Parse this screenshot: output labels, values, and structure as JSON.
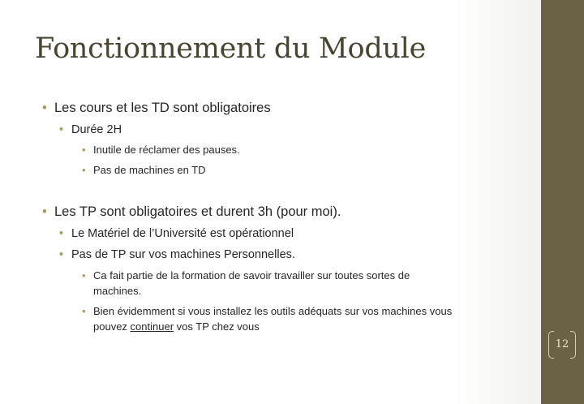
{
  "slide": {
    "title": "Fonctionnement du Module",
    "bullets": {
      "b1": "Les cours et les TD sont obligatoires",
      "b1_1": "Durée 2H",
      "b1_1_1": "Inutile de réclamer des pauses.",
      "b1_1_2": "Pas de machines en TD",
      "b2": "Les TP sont obligatoires et durent 3h (pour moi).",
      "b2_1": "Le Matériel de l’Université est opérationnel",
      "b2_2": "Pas de TP sur vos machines Personnelles.",
      "b2_2_1_line1": "Ca fait partie de la formation de savoir travailler sur toutes sortes de",
      "b2_2_1_line2": "machines.",
      "b2_2_2_line1": "Bien évidemment si vous installez les outils adéquats sur vos machines vous",
      "b2_2_2_pre": "pouvez ",
      "b2_2_2_link": "continuer",
      "b2_2_2_post": " vos TP chez vous"
    },
    "bullet_glyph": "•",
    "page_number": "12"
  },
  "colors": {
    "title": "#4a4330",
    "bullet": "#a49a63",
    "sidebar": "#6b6245",
    "text": "#262626"
  }
}
